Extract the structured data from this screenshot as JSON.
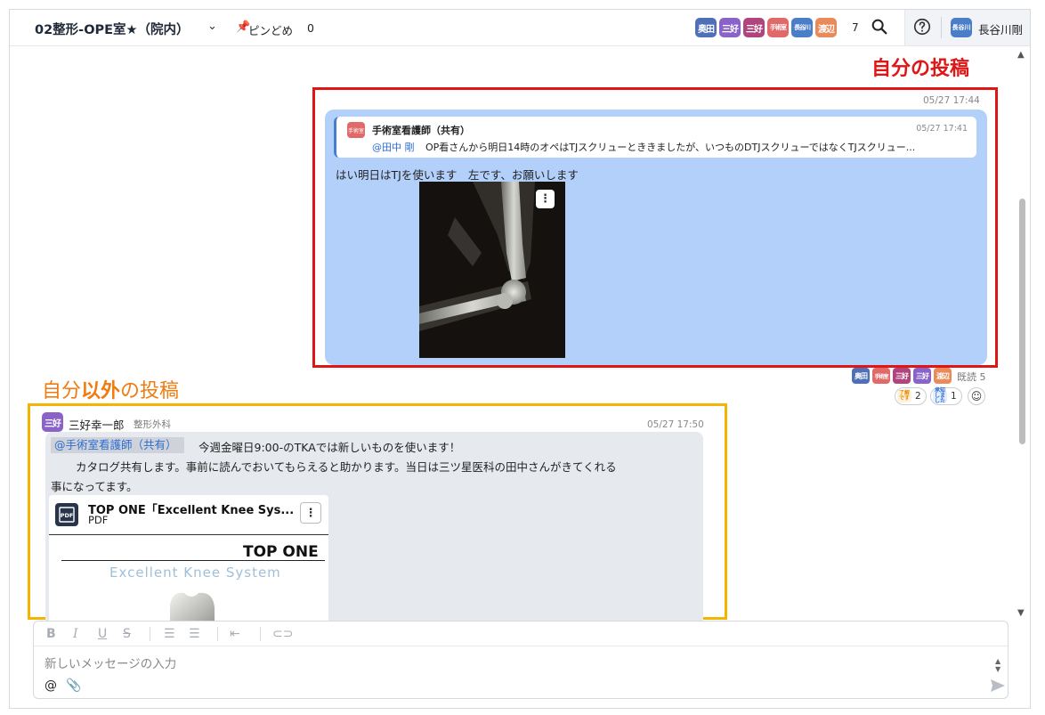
{
  "header": {
    "channel_title": "02整形-OPE室★（院内）",
    "pin_label": "ピンどめ",
    "pin_count": "0",
    "member_count": "7",
    "members": [
      {
        "label": "奥田",
        "color": "#4f6fb8"
      },
      {
        "label": "三好",
        "color": "#8a63c9"
      },
      {
        "label": "三好",
        "color": "#b0457d"
      },
      {
        "label": "手術室",
        "color": "#e06a6a"
      },
      {
        "label": "長谷川",
        "color": "#4a7ec9"
      },
      {
        "label": "渡辺",
        "color": "#e98a5a"
      }
    ],
    "user_avatar": "長谷川",
    "user_name": "長谷川剛"
  },
  "annotations": {
    "own_post": "自分の投稿",
    "other_post_prefix": "自分",
    "other_post_bold": "以外",
    "other_post_suffix": "の投稿"
  },
  "own_post": {
    "time": "05/27 17:44",
    "quote": {
      "avatar": "手術室",
      "author": "手術室看護師（共有）",
      "time": "05/27 17:41",
      "mention": "@田中 剛",
      "text": "OP看さんから明日14時のオペはTJスクリューとききましたが、いつものDTJスクリューではなくTJスクリュー..."
    },
    "text": "はい明日はTJを使います　左です、お願いします",
    "read_by": [
      {
        "label": "奥田",
        "color": "#4f6fb8"
      },
      {
        "label": "手術室",
        "color": "#e06a6a"
      },
      {
        "label": "三好",
        "color": "#b0457d"
      },
      {
        "label": "三好",
        "color": "#8a63c9"
      },
      {
        "label": "渡辺",
        "color": "#e98a5a"
      }
    ],
    "read_label": "既読 5",
    "reactions": [
      {
        "icon": "了解です",
        "count": "2",
        "color": "#f2a33a"
      },
      {
        "icon": "承知しました",
        "count": "1",
        "color": "#3f7be0"
      }
    ]
  },
  "other_post": {
    "avatar": "三好",
    "author": "三好幸一郎",
    "dept": "整形外科",
    "time": "05/27 17:50",
    "mention": "@手術室看護師（共有）",
    "line1": "今週金曜日9:00-のTKAでは新しいものを使います！",
    "line2": "カタログ共有します。事前に読んでおいてもらえると助かります。当日は三ツ星医科の田中さんがきてくれる",
    "line3": "事になってます。",
    "attachment": {
      "title": "TOP ONE「Excellent Knee Sys...",
      "type": "PDF",
      "brand": "TOP ONE",
      "subtitle": "Excellent Knee System"
    }
  },
  "composer": {
    "placeholder": "新しいメッセージの入力",
    "toolbar": [
      "B",
      "I",
      "U",
      "S",
      "bullets",
      "numbered",
      "indent",
      "link"
    ]
  },
  "icons": [
    "chevron-down-icon",
    "pin-icon",
    "search-icon",
    "help-icon",
    "kebab-menu-icon",
    "pdf-icon",
    "emoji-add-icon",
    "at-icon",
    "attach-icon",
    "send-icon"
  ]
}
